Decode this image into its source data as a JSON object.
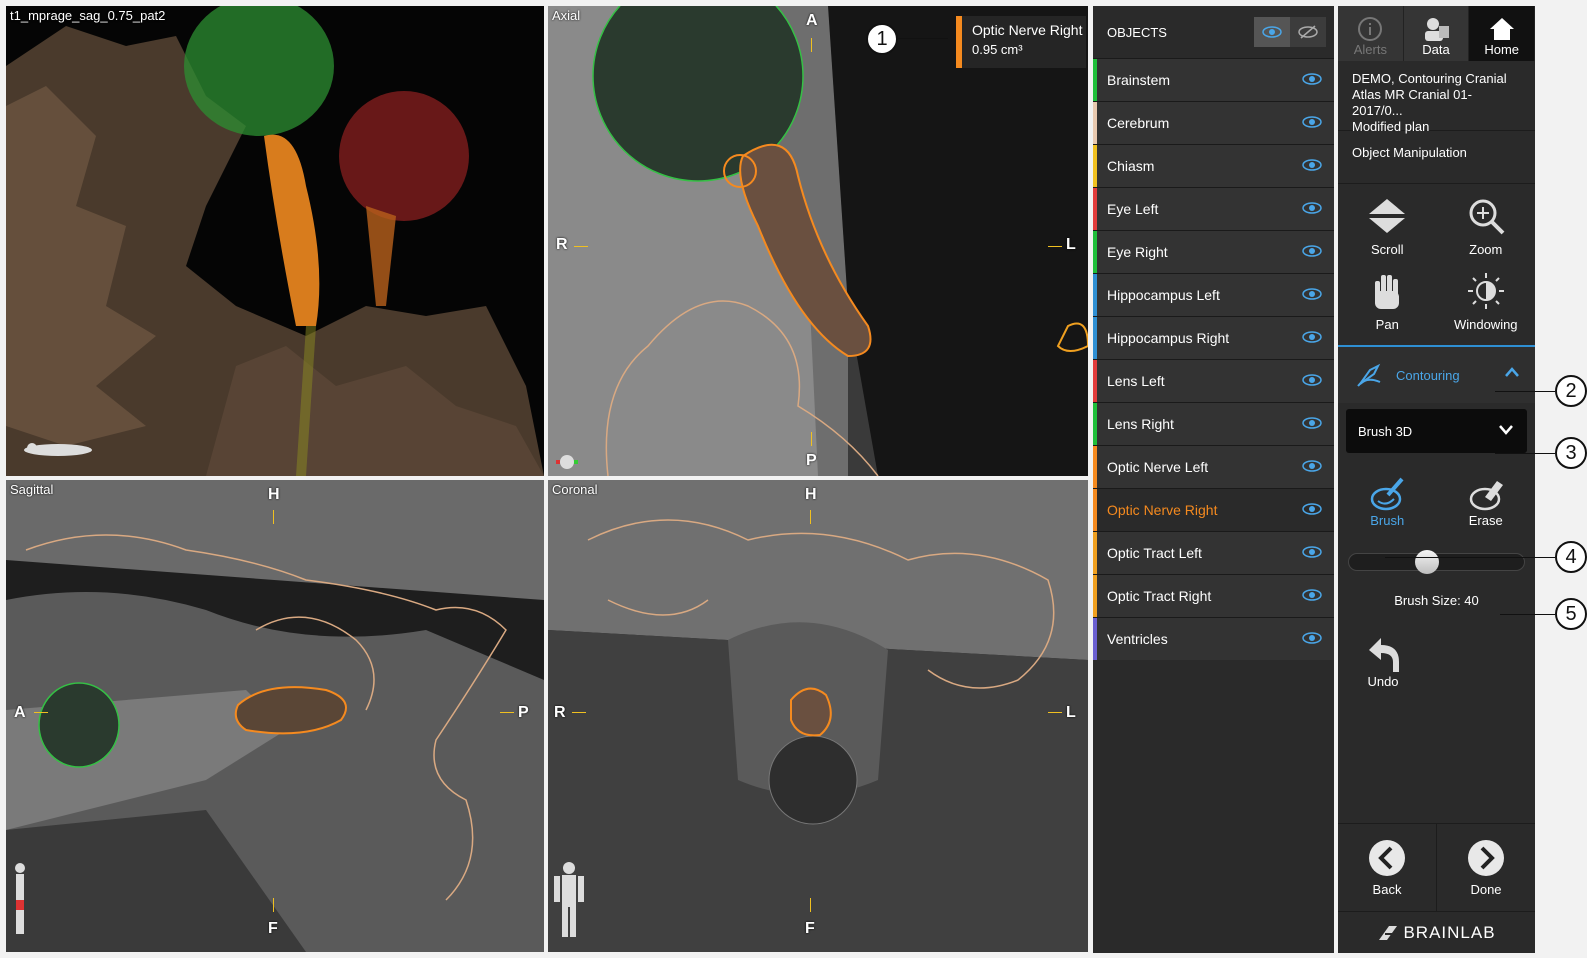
{
  "views": {
    "v3d": {
      "label": "t1_mprage_sag_0.75_pat2"
    },
    "axial": {
      "label": "Axial",
      "top": "A",
      "bottom": "P",
      "left": "R",
      "right": "L"
    },
    "sagittal": {
      "label": "Sagittal",
      "top": "H",
      "bottom": "F",
      "left": "A",
      "right": "P"
    },
    "coronal": {
      "label": "Coronal",
      "top": "H",
      "bottom": "F",
      "left": "R",
      "right": "L"
    }
  },
  "info": {
    "name": "Optic Nerve Right",
    "volume": "0.95 cm³",
    "color": "#f58a1f"
  },
  "objects": {
    "title": "OBJECTS",
    "items": [
      {
        "name": "Brainstem",
        "color": "#1fbf3a"
      },
      {
        "name": "Cerebrum",
        "color": "#e8c9b0"
      },
      {
        "name": "Chiasm",
        "color": "#f0c020"
      },
      {
        "name": "Eye Left",
        "color": "#e23b3b"
      },
      {
        "name": "Eye Right",
        "color": "#1fbf3a"
      },
      {
        "name": "Hippocampus Left",
        "color": "#2e8fd3"
      },
      {
        "name": "Hippocampus Right",
        "color": "#2e8fd3"
      },
      {
        "name": "Lens Left",
        "color": "#e23b3b"
      },
      {
        "name": "Lens Right",
        "color": "#1fbf3a"
      },
      {
        "name": "Optic Nerve Left",
        "color": "#f58a1f"
      },
      {
        "name": "Optic Nerve Right",
        "color": "#f58a1f",
        "selected": true
      },
      {
        "name": "Optic Tract Left",
        "color": "#f0a020"
      },
      {
        "name": "Optic Tract Right",
        "color": "#f0a020"
      },
      {
        "name": "Ventricles",
        "color": "#6a5fd0"
      }
    ]
  },
  "nav": {
    "alerts": "Alerts",
    "data": "Data",
    "home": "Home"
  },
  "plan": {
    "line1": "DEMO, Contouring Cranial",
    "line2": "Atlas MR Cranial 01-2017/0...",
    "line3": "Modified plan"
  },
  "object_manipulation": "Object Manipulation",
  "tools": {
    "scroll": "Scroll",
    "zoom": "Zoom",
    "pan": "Pan",
    "windowing": "Windowing"
  },
  "contouring": "Contouring",
  "brush_select": "Brush 3D",
  "brush_modes": {
    "brush": "Brush",
    "erase": "Erase"
  },
  "brush_size": {
    "label": "Brush Size: 40",
    "fraction": 0.43
  },
  "undo": "Undo",
  "bottom": {
    "back": "Back",
    "done": "Done"
  },
  "brand": "BRAINLAB",
  "callouts": [
    "1",
    "2",
    "3",
    "4",
    "5"
  ]
}
